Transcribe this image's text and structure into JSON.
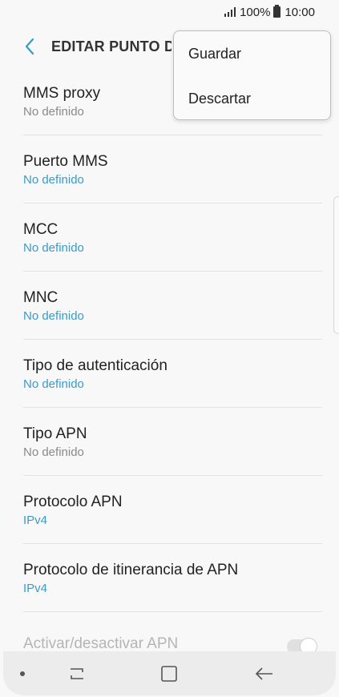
{
  "status_bar": {
    "battery": "100%",
    "time": "10:00"
  },
  "app_bar": {
    "title": "EDITAR PUNTO DE ACCESO"
  },
  "overflow_menu": {
    "items": [
      "Guardar",
      "Descartar"
    ]
  },
  "items": [
    {
      "title": "MMS proxy",
      "value": "No definido",
      "value_style": "gray"
    },
    {
      "title": "Puerto MMS",
      "value": "No definido",
      "value_style": "blue"
    },
    {
      "title": "MCC",
      "value": "No definido",
      "value_style": "blue"
    },
    {
      "title": "MNC",
      "value": "No definido",
      "value_style": "blue"
    },
    {
      "title": "Tipo de autenticación",
      "value": "No definido",
      "value_style": "blue"
    },
    {
      "title": "Tipo APN",
      "value": "No definido",
      "value_style": "gray"
    },
    {
      "title": "Protocolo APN",
      "value": "IPv4",
      "value_style": "blue"
    },
    {
      "title": "Protocolo de itinerancia de APN",
      "value": "IPv4",
      "value_style": "blue"
    }
  ],
  "toggle_item": {
    "title": "Activar/desactivar APN",
    "enabled": true
  },
  "colors": {
    "accent": "#3a9bc6",
    "secondary_text": "#8a8a8a",
    "background": "#f8f8f8"
  }
}
